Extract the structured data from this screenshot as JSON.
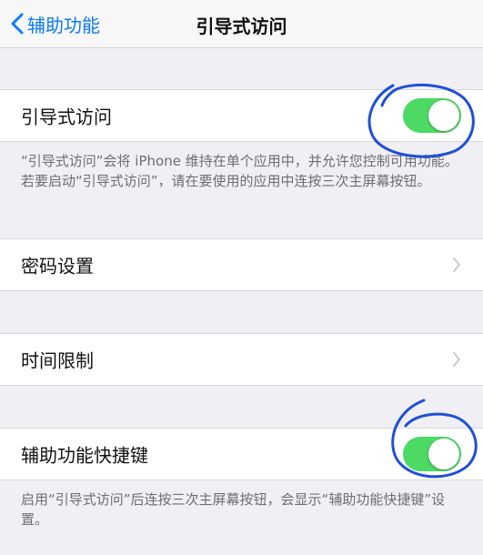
{
  "nav": {
    "back_label": "辅助功能",
    "title": "引导式访问"
  },
  "guided_access": {
    "label": "引导式访问",
    "enabled": true,
    "footer": "“引导式访问”会将 iPhone 维持在单个应用中，并允许您控制可用功能。若要启动“引导式访问”，请在要使用的应用中连按三次主屏幕按钮。"
  },
  "passcode": {
    "label": "密码设置"
  },
  "time_limits": {
    "label": "时间限制"
  },
  "accessibility_shortcut": {
    "label": "辅助功能快捷键",
    "enabled": true,
    "footer": "启用“引导式访问”后连按三次主屏幕按钮，会显示“辅助功能快捷键”设置。"
  },
  "colors": {
    "accent": "#0a7aff",
    "toggle_on": "#4cd964",
    "annotation": "#1f4fd8"
  }
}
